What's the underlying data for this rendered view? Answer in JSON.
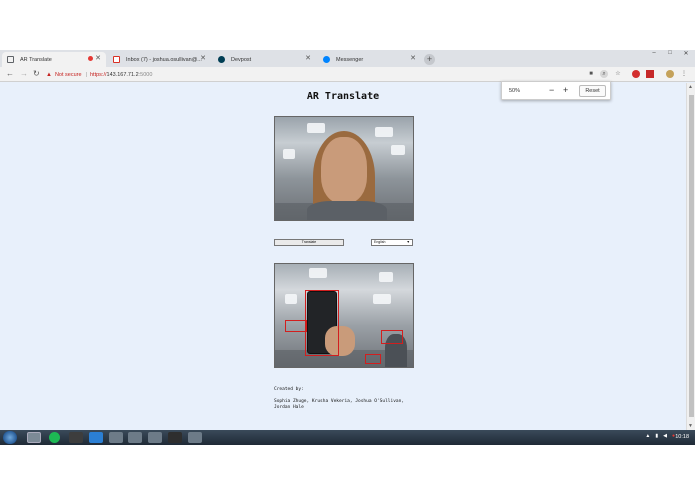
{
  "browser": {
    "tabs": [
      {
        "label": "AR Translate",
        "active": true,
        "icon": "page-icon",
        "icon_color": "#5f6368",
        "recording": true
      },
      {
        "label": "Inbox (7) - joshua.osullivan@...",
        "active": false,
        "icon": "gmail-icon",
        "icon_color": "#d93025"
      },
      {
        "label": "Devpost",
        "active": false,
        "icon": "devpost-icon",
        "icon_color": "#003e54"
      },
      {
        "label": "Messenger",
        "active": false,
        "icon": "messenger-icon",
        "icon_color": "#0084ff"
      }
    ],
    "address": {
      "warning": "Not secure",
      "scheme": "https://",
      "host": "143.167.71.2",
      "port": ":5000"
    },
    "zoom": {
      "value": "50%",
      "minus": "−",
      "plus": "+",
      "reset": "Reset"
    }
  },
  "page": {
    "title": "AR Translate",
    "translate_button": "Translate",
    "language_select": "English",
    "credits_heading": "Created by:",
    "credits_line1": "Sophia Zhuge, Krusha Vekeria, Joshua O'Sullivan,",
    "credits_line2": "Jordan Hale"
  },
  "taskbar": {
    "clock": "10:18"
  },
  "colors": {
    "page_background": "#e8f0fb",
    "detection_box": "#d21e1e",
    "not_secure": "#c5221f"
  }
}
